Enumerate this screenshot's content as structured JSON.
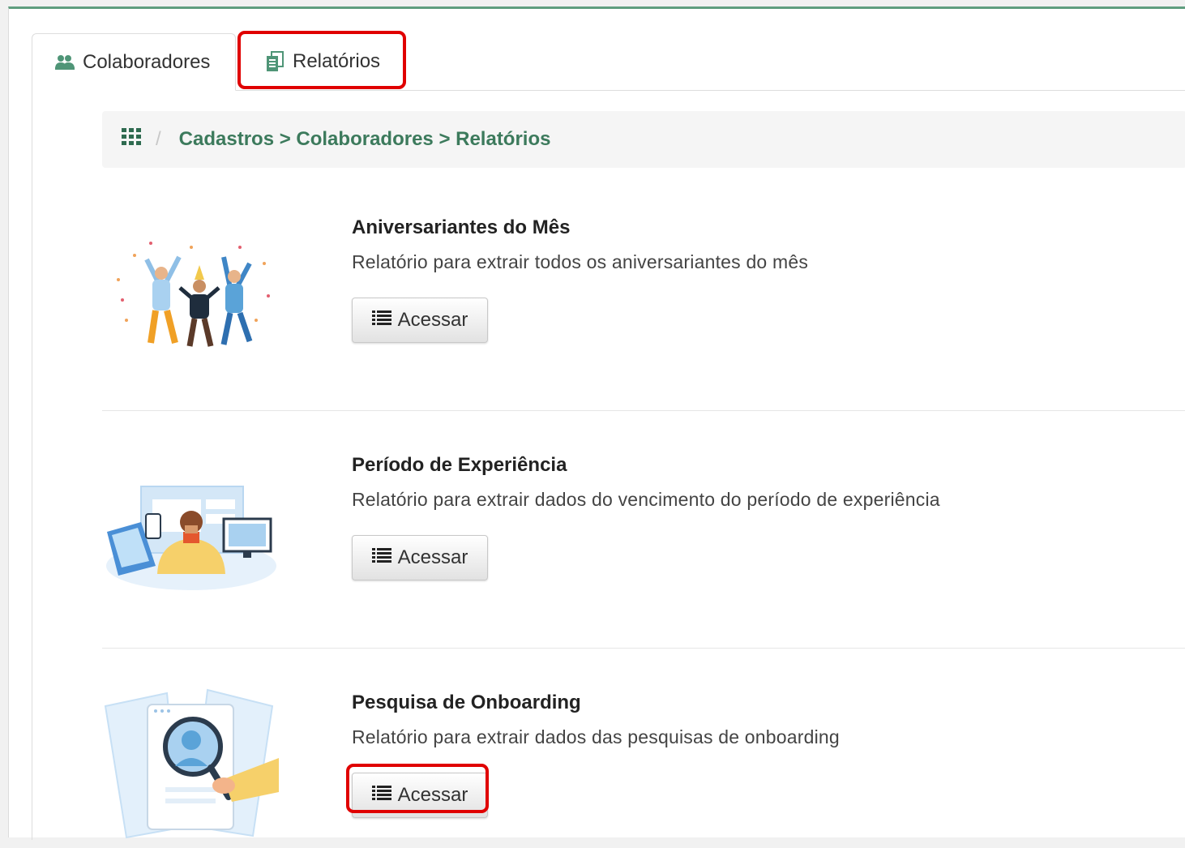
{
  "tabs": [
    {
      "label": "Colaboradores",
      "icon": "users-icon"
    },
    {
      "label": "Relatórios",
      "icon": "reports-icon"
    }
  ],
  "breadcrumb": {
    "separator": "/",
    "path": "Cadastros > Colaboradores > Relatórios"
  },
  "reports": [
    {
      "title": "Aniversariantes do Mês",
      "description": "Relatório para extrair todos os aniversariantes do mês",
      "button_label": "Acessar"
    },
    {
      "title": "Período de Experiência",
      "description": "Relatório para extrair dados do vencimento do período de experiência",
      "button_label": "Acessar"
    },
    {
      "title": "Pesquisa de Onboarding",
      "description": "Relatório para extrair dados das pesquisas de onboarding",
      "button_label": "Acessar"
    }
  ],
  "colors": {
    "accent": "#3c7a5c",
    "highlight": "#e00000"
  }
}
